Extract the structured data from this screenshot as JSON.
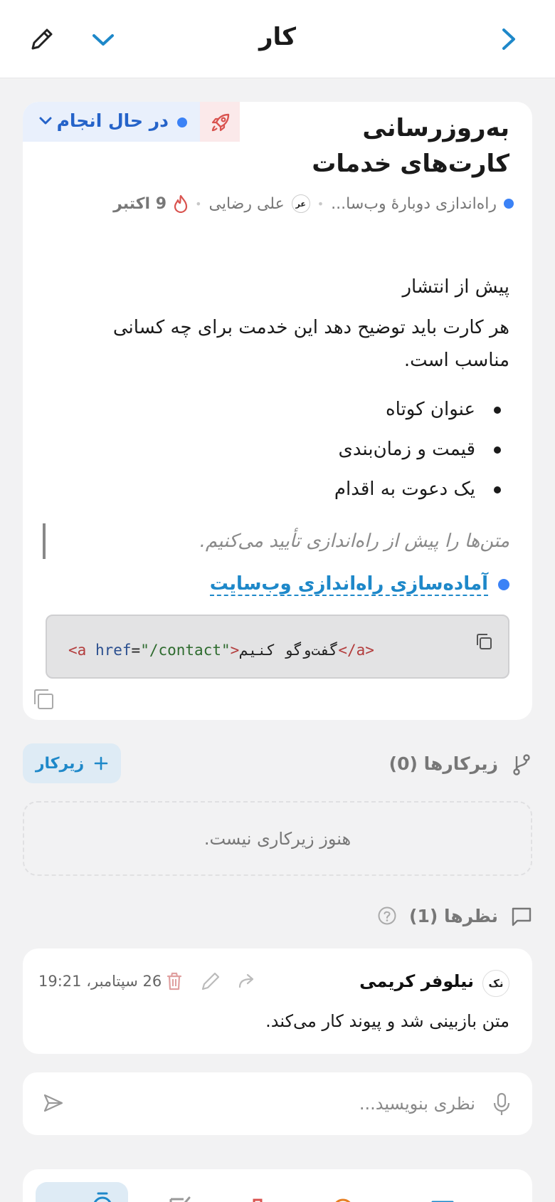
{
  "header": {
    "title": "کار"
  },
  "task": {
    "title": "به‌روزرسانی کارت‌های خدمات",
    "status": "در حال انجام",
    "project": "راه‌اندازی دوبارهٔ وب‌سا...",
    "assignee_initials": "عر",
    "assignee": "علی رضایی",
    "due_date": "9 اکتبر",
    "status_color": "#3b82f6"
  },
  "description": {
    "section_heading": "پیش از انتشار",
    "paragraph": "هر کارت باید توضیح دهد این خدمت برای چه کسانی مناسب است.",
    "bullets": [
      "عنوان کوتاه",
      "قیمت و زمان‌بندی",
      "یک دعوت به اقدام"
    ],
    "quote": "متن‌ها را پیش از راه‌اندازی تأیید می‌کنیم.",
    "linked_doc": "آماده‌سازی راه‌اندازی وب‌سایت",
    "code": {
      "open_tag_start": "<a",
      "attr_name": "href",
      "attr_value": "\"/contact\"",
      "open_tag_end": ">",
      "text": "گفت‌وگو کنیم",
      "close_tag": "</a>"
    }
  },
  "subtasks": {
    "heading": "زیرکارها (0)",
    "add_button": "زیرکار",
    "empty_message": "هنوز زیرکاری نیست."
  },
  "comments": {
    "heading": "نظرها (1)",
    "items": [
      {
        "initials": "نک",
        "author": "نیلوفر کریمی",
        "time": "26 سپتامبر، 19:21",
        "text": "متن بازبینی شد و پیوند کار می‌کند."
      }
    ],
    "composer_placeholder": "نظری بنویسید..."
  },
  "colors": {
    "accent": "#1e88c9",
    "danger": "#d9534f"
  }
}
